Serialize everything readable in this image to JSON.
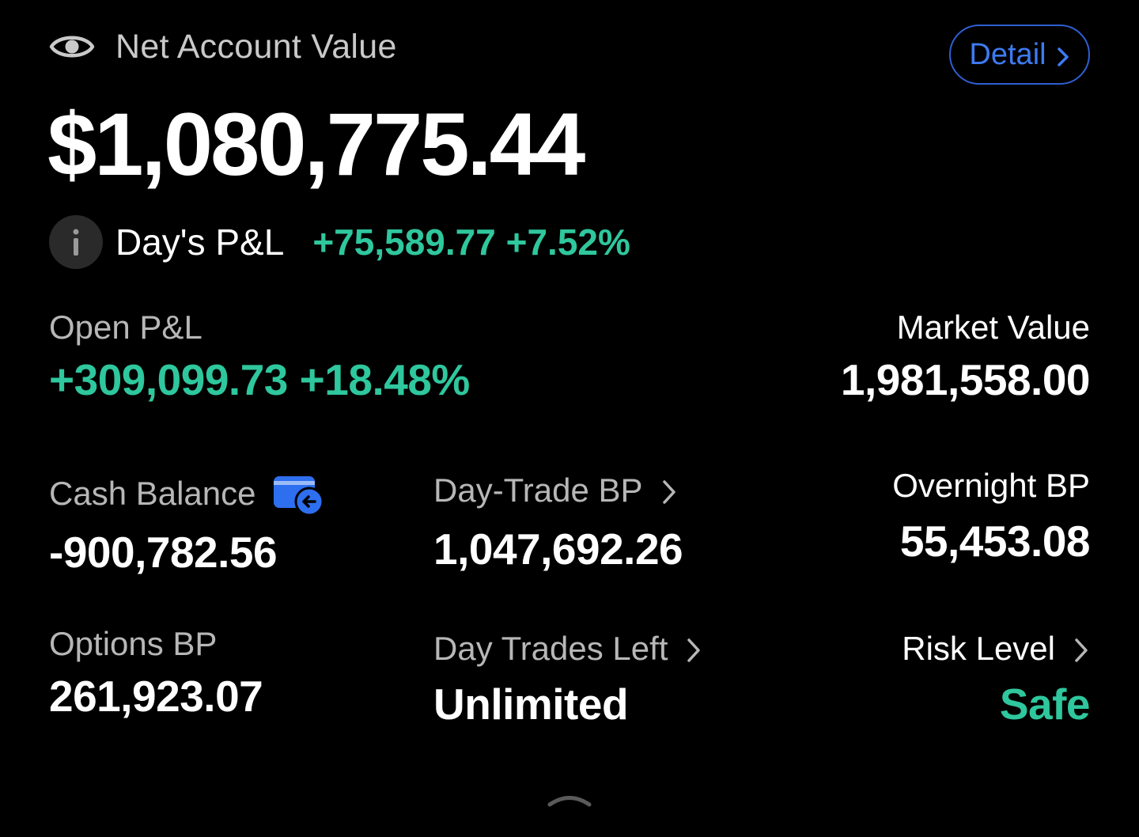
{
  "header": {
    "title": "Net Account Value",
    "detail_label": "Detail",
    "eye_icon": "eye-icon"
  },
  "account": {
    "net_value": "$1,080,775.44",
    "day_pl_label": "Day's P&L",
    "day_pl_value": "+75,589.77 +7.52%"
  },
  "metrics": {
    "open_pl": {
      "label": "Open P&L",
      "value": "+309,099.73 +18.48%"
    },
    "market_value": {
      "label": "Market Value",
      "value": "1,981,558.00"
    },
    "cash_balance": {
      "label": "Cash Balance",
      "value": "-900,782.56"
    },
    "day_trade_bp": {
      "label": "Day-Trade BP",
      "value": "1,047,692.26"
    },
    "overnight_bp": {
      "label": "Overnight BP",
      "value": "55,453.08"
    },
    "options_bp": {
      "label": "Options BP",
      "value": "261,923.07"
    },
    "day_trades_left": {
      "label": "Day Trades Left",
      "value": "Unlimited"
    },
    "risk_level": {
      "label": "Risk Level",
      "value": "Safe"
    }
  },
  "colors": {
    "background": "#000000",
    "positive": "#2fc79d",
    "accent": "#3d7bf2",
    "muted_text": "#b7b7b7"
  }
}
